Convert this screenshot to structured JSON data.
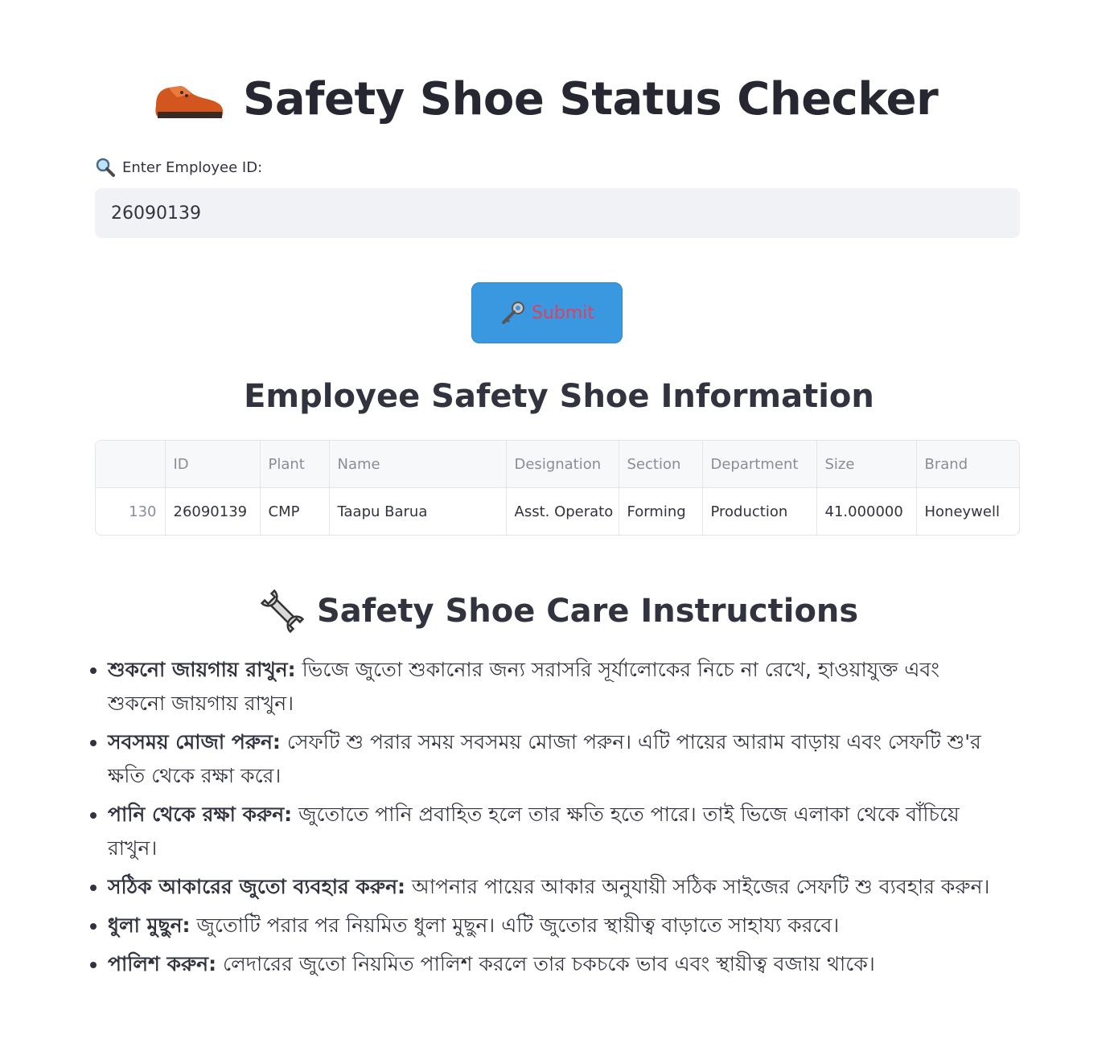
{
  "header": {
    "title": "Safety Shoe Status Checker",
    "icon": "shoe-icon"
  },
  "search": {
    "label": "Enter Employee ID:",
    "label_icon": "magnifier-icon",
    "value": "26090139"
  },
  "submit": {
    "label": "Submit",
    "icon": "key-icon",
    "color": "#3a98e0",
    "text_color": "#e0405a"
  },
  "info": {
    "title": "Employee Safety Shoe Information",
    "columns": [
      "",
      "ID",
      "Plant",
      "Name",
      "Designation",
      "Section",
      "Department",
      "Size",
      "Brand"
    ],
    "rows": [
      [
        "130",
        "26090139",
        "CMP",
        "Taapu Barua",
        "Asst. Operato",
        "Forming",
        "Production",
        "41.000000",
        "Honeywell"
      ]
    ]
  },
  "care": {
    "title": "Safety Shoe Care Instructions",
    "icon": "wrench-icon",
    "items": [
      {
        "head": "শুকনো জায়গায় রাখুন:",
        "text": " ভিজে জুতো শুকানোর জন্য সরাসরি সূর্যালোকের নিচে না রেখে, হাওয়াযুক্ত এবং শুকনো জায়গায় রাখুন।"
      },
      {
        "head": "সবসময় মোজা পরুন:",
        "text": " সেফটি শু পরার সময় সবসময় মোজা পরুন। এটি পায়ের আরাম বাড়ায় এবং সেফটি শু'র ক্ষতি থেকে রক্ষা করে।"
      },
      {
        "head": "পানি থেকে রক্ষা করুন:",
        "text": " জুতোতে পানি প্রবাহিত হলে তার ক্ষতি হতে পারে। তাই ভিজে এলাকা থেকে বাঁচিয়ে রাখুন।"
      },
      {
        "head": "সঠিক আকারের জুতো ব্যবহার করুন:",
        "text": " আপনার পায়ের আকার অনুযায়ী সঠিক সাইজের সেফটি শু ব্যবহার করুন।"
      },
      {
        "head": "ধুলা মুছুন:",
        "text": " জুতোটি পরার পর নিয়মিত ধুলা মুছুন। এটি জুতোর স্থায়ীত্ব বাড়াতে সাহায্য করবে।"
      },
      {
        "head": "পালিশ করুন:",
        "text": " লেদারের জুতো নিয়মিত পালিশ করলে তার চকচকে ভাব এবং স্থায়ীত্ব বজায় থাকে।"
      }
    ]
  }
}
